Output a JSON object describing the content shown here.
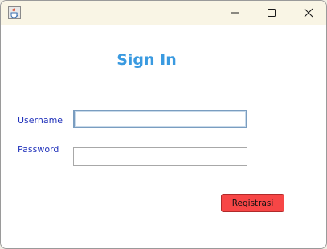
{
  "window": {
    "icon": "java-coffee-cup-icon",
    "controls": {
      "minimize_icon": "minimize-icon",
      "maximize_icon": "maximize-icon",
      "close_icon": "close-icon"
    }
  },
  "form": {
    "title": "Sign In",
    "username_label": "Username",
    "username_value": "",
    "password_label": "Password",
    "password_value": "",
    "register_button": "Registrasi"
  },
  "colors": {
    "title": "#3a9ae0",
    "labels": "#2233bb",
    "register_button": "#f74646",
    "titlebar": "#f9f5e5"
  }
}
